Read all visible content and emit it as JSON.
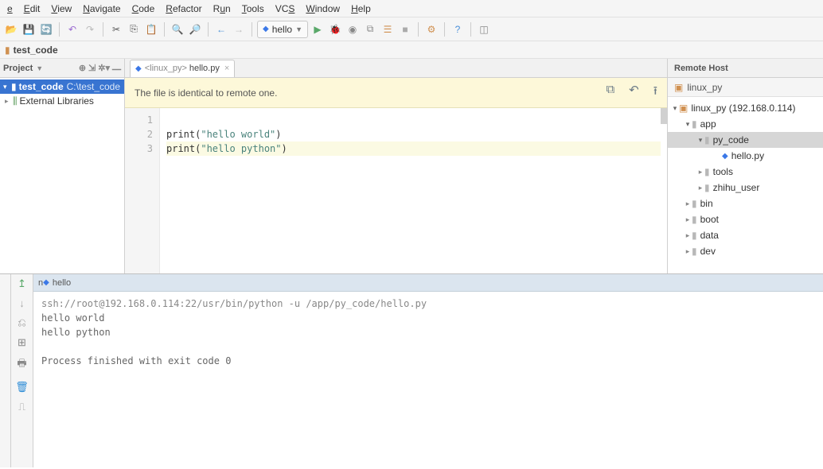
{
  "menu": [
    "e",
    "Edit",
    "View",
    "Navigate",
    "Code",
    "Refactor",
    "Run",
    "Tools",
    "VCS",
    "Window",
    "Help"
  ],
  "run_config_label": "hello",
  "crumb": "test_code",
  "project": {
    "title": "Project",
    "root_name": "test_code",
    "root_path": "C:\\test_code",
    "external_libs": "External Libraries"
  },
  "editor": {
    "tab_prefix": "<linux_py>",
    "tab_file": "hello.py",
    "notice": "The file is identical to remote one.",
    "lines": [
      {
        "n": "1",
        "html": ""
      },
      {
        "n": "2",
        "html": "print(<span class='str'>\"hello world\"</span>)"
      },
      {
        "n": "3",
        "html": "print(<span class='str'>\"hello python\"</span>)",
        "hl": true
      }
    ]
  },
  "remote": {
    "header": "Remote Host",
    "subhost": "linux_py",
    "tree": [
      {
        "indent": 4,
        "arrow": "▾",
        "kind": "srv",
        "label": "linux_py (192.168.0.114)"
      },
      {
        "indent": 20,
        "arrow": "▾",
        "kind": "fold",
        "label": "app"
      },
      {
        "indent": 36,
        "arrow": "▾",
        "kind": "fold",
        "label": "py_code",
        "sel": true
      },
      {
        "indent": 58,
        "arrow": "",
        "kind": "py",
        "label": "hello.py"
      },
      {
        "indent": 36,
        "arrow": "▸",
        "kind": "fold",
        "label": "tools"
      },
      {
        "indent": 36,
        "arrow": "▸",
        "kind": "fold",
        "label": "zhihu_user"
      },
      {
        "indent": 20,
        "arrow": "▸",
        "kind": "fold",
        "label": "bin"
      },
      {
        "indent": 20,
        "arrow": "▸",
        "kind": "fold",
        "label": "boot"
      },
      {
        "indent": 20,
        "arrow": "▸",
        "kind": "fold",
        "label": "data"
      },
      {
        "indent": 20,
        "arrow": "▸",
        "kind": "fold",
        "label": "dev"
      }
    ]
  },
  "console": {
    "tab_label": "hello",
    "cmd": "ssh://root@192.168.0.114:22/usr/bin/python -u /app/py_code/hello.py",
    "out1": "hello world",
    "out2": "hello python",
    "exit": "Process finished with exit code 0"
  }
}
